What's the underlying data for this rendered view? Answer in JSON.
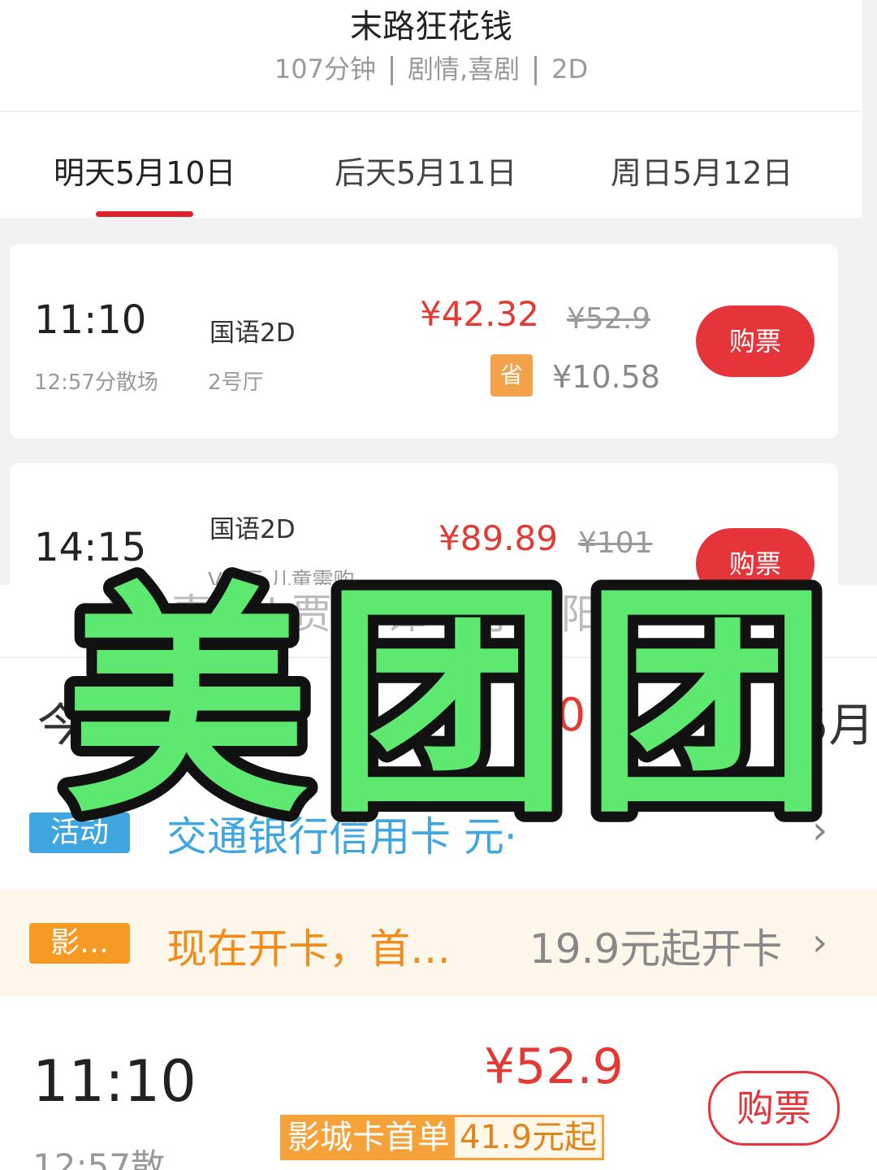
{
  "movie": {
    "title": "末路狂花钱",
    "duration": "107分钟",
    "genre": "剧情,喜剧",
    "format": "2D"
  },
  "date_tabs": [
    {
      "label": "明天5月10日",
      "active": true
    },
    {
      "label": "后天5月11日",
      "active": false
    },
    {
      "label": "周日5月12日",
      "active": false
    }
  ],
  "showtimes": [
    {
      "time": "11:10",
      "end": "12:57分散场",
      "language": "国语2D",
      "hall": "2号厅",
      "price": "¥42.32",
      "original_price": "¥52.9",
      "save_badge": "省",
      "saved": "¥10.58",
      "buy_label": "购票"
    },
    {
      "time": "14:15",
      "language": "国语2D",
      "hall": "VIP厅-儿童需购",
      "price": "¥89.89",
      "original_price": "¥101",
      "buy_label": "购票"
    }
  ],
  "bottom": {
    "meta_text": "| 喜剧 | 贾冰 谭卓,小沈阳",
    "meta_lead": "1",
    "date_tabs": [
      "今天",
      "日",
      "10",
      "5月"
    ],
    "activity": {
      "tag": "活动",
      "text": "交通银行信用卡 元·"
    },
    "card_promo": {
      "tag": "影…",
      "text": "现在开卡，首…",
      "right": "19.9元起开卡"
    },
    "showtime": {
      "time": "11:10",
      "end": "12:57散",
      "price": "¥52.9",
      "badge_left": "影城卡首单",
      "badge_right": "41.9元起",
      "buy_label": "购票"
    }
  },
  "sticker": {
    "text": "美团团",
    "fill": "#5de86f",
    "outline": "#111111"
  },
  "colors": {
    "accent_red": "#e5343a",
    "price_red": "#e33a33",
    "save_orange": "#f3a24b",
    "activity_blue": "#3fa6e0",
    "promo_orange": "#f59a23"
  }
}
